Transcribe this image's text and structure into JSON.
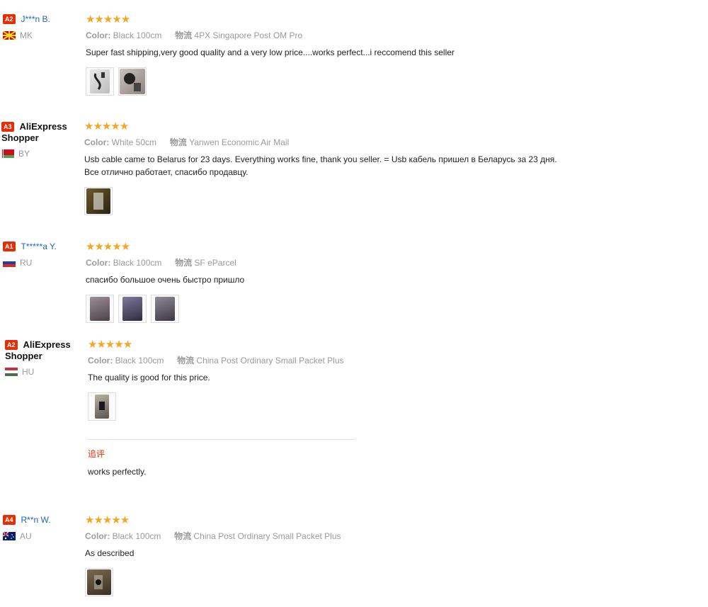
{
  "reviews": [
    {
      "badge": "A2",
      "name": "J***n B.",
      "name_style": "blue",
      "country": "MK",
      "stars": "★★★★★",
      "color_label": "Color:",
      "color_value": "Black 100cm",
      "ship_label": "物流",
      "ship_value": "4PX Singapore Post OM Pro",
      "text": "Super fast shipping,very good quality and a very low price....works perfect...i reccomend this seller",
      "photos": 2
    },
    {
      "badge": "A3",
      "name": "AliExpress",
      "name2": "Shopper",
      "name_style": "dark",
      "country": "BY",
      "stars": "★★★★★",
      "color_label": "Color:",
      "color_value": "White 50cm",
      "ship_label": "物流",
      "ship_value": "Yanwen Economic Air Mail",
      "text": "Usb cable came to Belarus for 23 days. Everything works fine, thank you seller. = Usb кабель пришел в Беларусь за 23 дня.",
      "text2": "Все отлично работает, спасибо продавцу.",
      "photos": 1
    },
    {
      "badge": "A1",
      "name": "T*****a Y.",
      "name_style": "blue",
      "country": "RU",
      "stars": "★★★★★",
      "color_label": "Color:",
      "color_value": "Black 100cm",
      "ship_label": "物流",
      "ship_value": "SF eParcel",
      "text": "спасибо большое очень быстро пришло",
      "photos": 3
    },
    {
      "badge": "A2",
      "name": "AliExpress",
      "name2": "Shopper",
      "name_style": "dark",
      "country": "HU",
      "stars": "★★★★★",
      "color_label": "Color:",
      "color_value": "Black 100cm",
      "ship_label": "物流",
      "ship_value": "China Post Ordinary Small Packet Plus",
      "text": "The quality is good for this price.",
      "photos": 1,
      "followup_label": "追评",
      "followup_text": "works perfectly."
    },
    {
      "badge": "A4",
      "name": "R**n W.",
      "name_style": "blue",
      "country": "AU",
      "stars": "★★★★★",
      "color_label": "Color:",
      "color_value": "Black 100cm",
      "ship_label": "物流",
      "ship_value": "China Post Ordinary Small Packet Plus",
      "text": "As described",
      "photos": 1
    }
  ],
  "colors": {
    "badge": "#e62e04",
    "star": "#f5a623",
    "name_link": "#2462b4"
  }
}
